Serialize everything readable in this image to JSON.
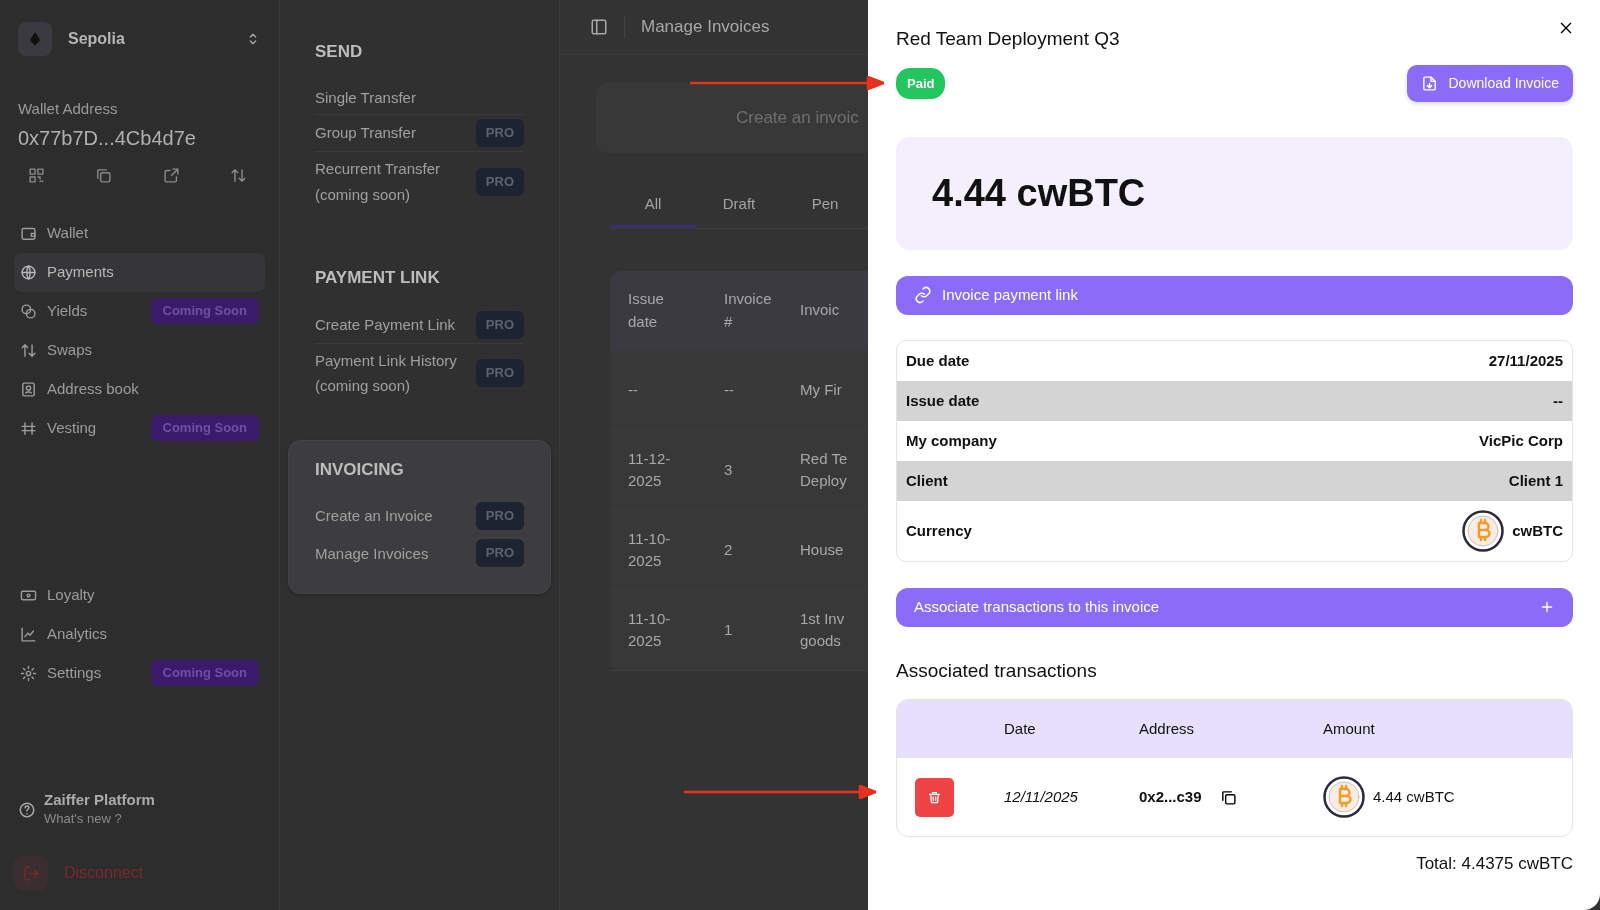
{
  "network": {
    "name": "Sepolia"
  },
  "wallet": {
    "label": "Wallet Address",
    "address": "0x77b7D...4Cb4d7e"
  },
  "sidebar": {
    "items": [
      {
        "label": "Wallet",
        "selected": false
      },
      {
        "label": "Payments",
        "selected": true
      },
      {
        "label": "Yields",
        "selected": false,
        "badge": "Coming Soon"
      },
      {
        "label": "Swaps",
        "selected": false
      },
      {
        "label": "Address book",
        "selected": false
      },
      {
        "label": "Vesting",
        "selected": false,
        "badge": "Coming Soon"
      }
    ],
    "lower_items": [
      {
        "label": "Loyalty",
        "selected": false
      },
      {
        "label": "Analytics",
        "selected": false
      },
      {
        "label": "Settings",
        "selected": false,
        "badge": "Coming Soon"
      }
    ],
    "footer": {
      "title": "Zaiffer Platform",
      "subtitle": "What's new ?"
    },
    "disconnect": "Disconnect"
  },
  "submenu": {
    "sections": [
      {
        "title": "SEND",
        "selected": false,
        "items": [
          {
            "label": "Single Transfer"
          },
          {
            "label": "Group Transfer",
            "badge": "PRO"
          },
          {
            "label": "Recurrent Transfer (coming soon)",
            "badge": "PRO"
          }
        ]
      },
      {
        "title": "PAYMENT LINK",
        "selected": false,
        "items": [
          {
            "label": "Create Payment Link",
            "badge": "PRO"
          },
          {
            "label": "Payment Link History (coming soon)",
            "badge": "PRO"
          }
        ]
      },
      {
        "title": "INVOICING",
        "selected": true,
        "items": [
          {
            "label": "Create an Invoice",
            "badge": "PRO"
          },
          {
            "label": "Manage Invoices",
            "badge": "PRO"
          }
        ]
      }
    ]
  },
  "header": {
    "title": "Manage Invoices"
  },
  "create_card": {
    "text": "Create an invoic"
  },
  "tabs": [
    {
      "label": "All",
      "selected": true
    },
    {
      "label": "Draft",
      "selected": false
    },
    {
      "label": "Pen",
      "selected": false
    }
  ],
  "invoices": {
    "columns": [
      "Issue\ndate",
      "Invoice\n#",
      "Invoic"
    ],
    "rows": [
      [
        "--",
        "--",
        "My Fir"
      ],
      [
        "11-12-\n2025",
        "3",
        "Red Te\nDeploy"
      ],
      [
        "11-10-\n2025",
        "2",
        "House"
      ],
      [
        "11-10-\n2025",
        "1",
        "1st Inv\ngoods"
      ]
    ]
  },
  "panel": {
    "title": "Red Team Deployment Q3",
    "status": {
      "label": "Paid",
      "kind": "paid"
    },
    "download_button": "Download Invoice",
    "amount": "4.44 cwBTC",
    "payment_link_button": "Invoice payment link",
    "details": [
      {
        "kind": "text",
        "label": "Due date",
        "value": "27/11/2025"
      },
      {
        "kind": "text",
        "label": "Issue date",
        "value": "--"
      },
      {
        "kind": "text",
        "label": "My company",
        "value": "VicPic Corp"
      },
      {
        "kind": "text",
        "label": "Client",
        "value": "Client 1"
      },
      {
        "kind": "currency",
        "label": "Currency",
        "value": "cwBTC"
      }
    ],
    "associate_button": "Associate transactions to this invoice",
    "transactions_title": "Associated transactions",
    "transaction_columns": [
      "Date",
      "Address",
      "Amount"
    ],
    "transactions": [
      {
        "date": "12/11/2025",
        "address": "0x2...c39",
        "amount": "4.44 cwBTC"
      }
    ],
    "total": "Total: 4.4375 cwBTC"
  }
}
